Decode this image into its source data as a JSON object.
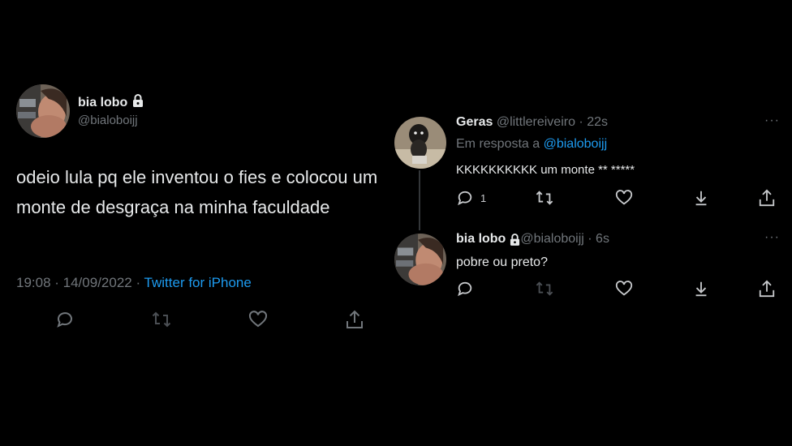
{
  "main_tweet": {
    "display_name": "bia lobo",
    "handle": "@bialoboijj",
    "text": "odeio lula pq ele inventou o fies e colocou um monte de desgraça na minha faculdade",
    "time_date": "19:08 · 14/09/2022 · ",
    "source": "Twitter for iPhone"
  },
  "reply_1": {
    "display_name": "Geras",
    "handle_time": " @littlereiveiro · 22s",
    "replying_prefix": "Em resposta a ",
    "replying_mention": "@bialoboijj",
    "text": "KKKKKKKKKK um monte ** *****",
    "reply_count": "1",
    "more": "···"
  },
  "reply_2": {
    "display_name": "bia lobo",
    "handle_time": " @bialoboijj · 6s",
    "text": "pobre ou preto?",
    "more": "···"
  },
  "colors": {
    "background": "#000000",
    "text_primary": "#e7e9ea",
    "text_secondary": "#71767b",
    "accent": "#1d9bf0"
  },
  "icons": [
    "comment-icon",
    "retweet-icon",
    "like-icon",
    "share-icon",
    "download-icon",
    "lock-icon",
    "more-icon"
  ]
}
